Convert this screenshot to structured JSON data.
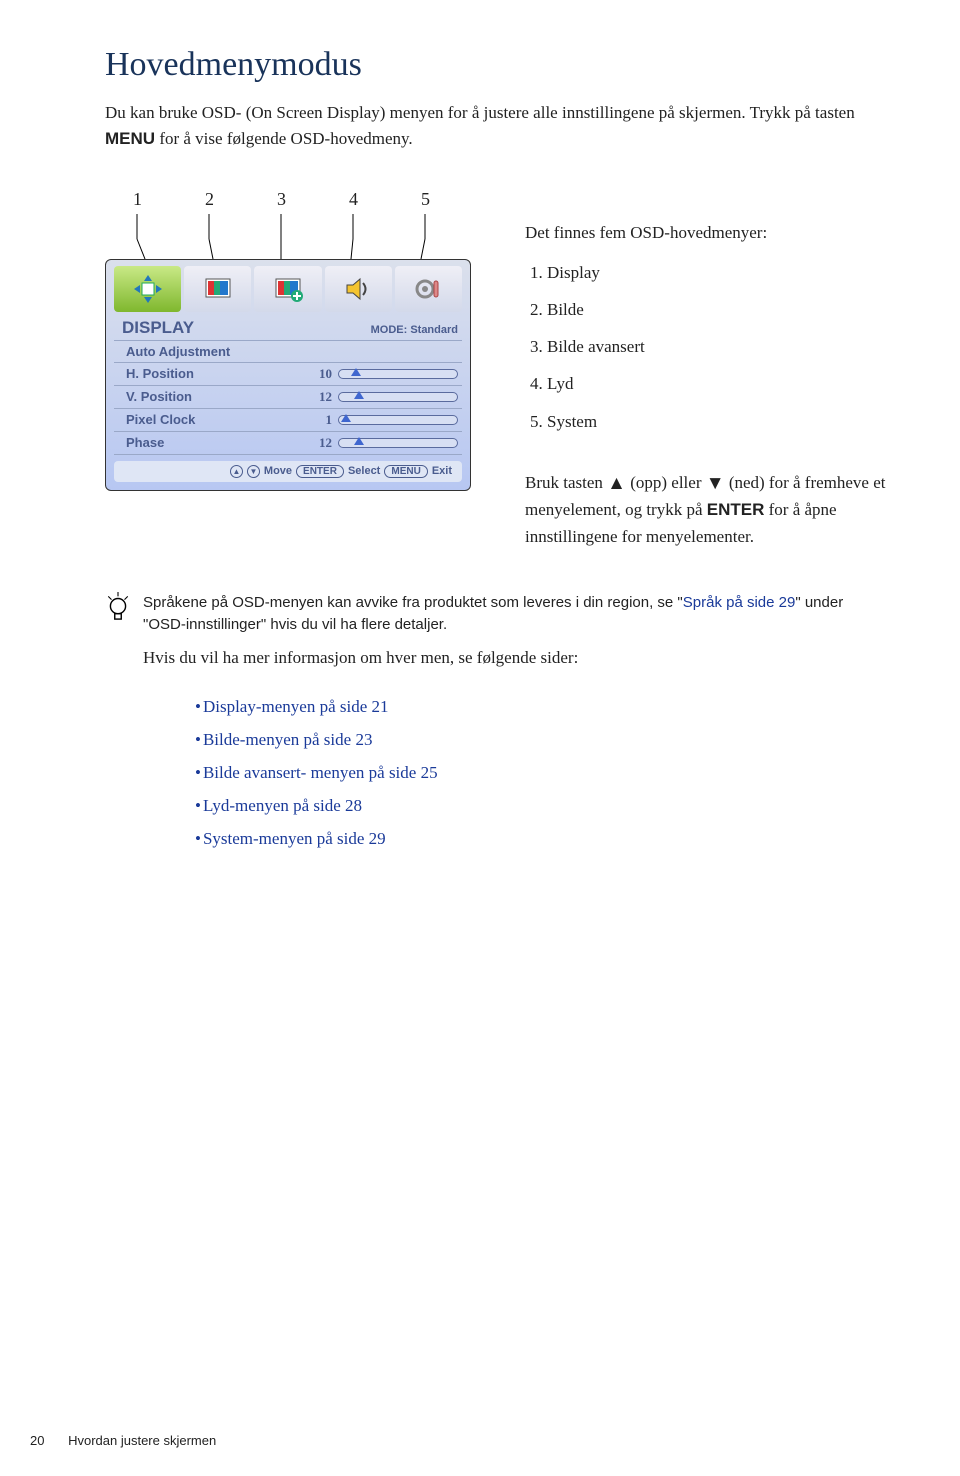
{
  "title": "Hovedmenymodus",
  "intro": {
    "part1": "Du kan bruke OSD- (On Screen Display) menyen for å justere alle innstillingene på skjermen. Trykk på tasten ",
    "menu": "MENU",
    "part2": " for å vise følgende OSD-hovedmeny."
  },
  "callouts": [
    "1",
    "2",
    "3",
    "4",
    "5"
  ],
  "osd": {
    "title": "DISPLAY",
    "mode": "MODE: Standard",
    "rows": [
      {
        "label": "Auto Adjustment",
        "value": "",
        "bar": false
      },
      {
        "label": "H. Position",
        "value": "10",
        "bar": true,
        "pos": 10
      },
      {
        "label": "V. Position",
        "value": "12",
        "bar": true,
        "pos": 13
      },
      {
        "label": "Pixel Clock",
        "value": "1",
        "bar": true,
        "pos": 2
      },
      {
        "label": "Phase",
        "value": "12",
        "bar": true,
        "pos": 13
      }
    ],
    "foot": {
      "move": "Move",
      "enter": "ENTER",
      "select": "Select",
      "menu": "MENU",
      "exit": "Exit"
    }
  },
  "right": {
    "heading": "Det finnes fem OSD-hovedmenyer:",
    "items": [
      "Display",
      "Bilde",
      "Bilde avansert",
      "Lyd",
      "System"
    ]
  },
  "arrowdesc": {
    "p1": "Bruk tasten ",
    "up_hint": "(opp) eller",
    "down_hint": "(ned) for å fremheve et menyelement, og trykk på ",
    "enter": "ENTER",
    "p2": " for å åpne innstillingene for menyelementer."
  },
  "tip": {
    "line1a": "Språkene på OSD-menyen kan avvike fra produktet som leveres i din region, se \"",
    "link": "Språk på side 29",
    "line1b": "\" under \"OSD-innstillinger\" hvis du vil ha flere detaljer."
  },
  "after_tip": "Hvis du vil ha mer informasjon om hver men, se følgende sider:",
  "links": [
    "Display-menyen på side 21",
    "Bilde-menyen på side 23",
    "Bilde avansert- menyen på side 25",
    "Lyd-menyen på side 28",
    "System-menyen på side 29"
  ],
  "footer": {
    "page": "20",
    "text": "Hvordan justere skjermen"
  }
}
